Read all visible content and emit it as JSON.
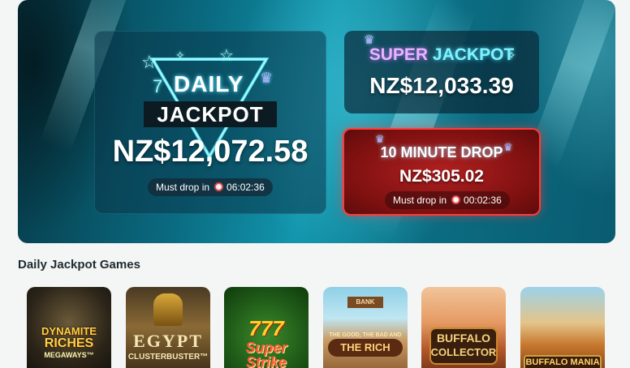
{
  "daily": {
    "word1": "DAILY",
    "word2": "JACKPOT",
    "amount": "NZ$12,072.58",
    "must_drop_label": "Must drop in",
    "timer": "06:02:36"
  },
  "super": {
    "title_part1": "SUPER",
    "title_part2": "JACKPOT",
    "amount": "NZ$12,033.39"
  },
  "ten_minute": {
    "title": "10 MINUTE DROP",
    "amount": "NZ$305.02",
    "must_drop_label": "Must drop in",
    "timer": "00:02:36"
  },
  "section": {
    "title": "Daily Jackpot Games"
  },
  "games": [
    {
      "title": "DYNAMITE",
      "subtitle": "RICHES",
      "extra": "MEGAWAYS™"
    },
    {
      "title": "EGYPT",
      "subtitle": "CLUSTERBUSTER™",
      "extra": ""
    },
    {
      "title": "Super",
      "subtitle": "Strike",
      "extra": ""
    },
    {
      "title": "THE GOOD, THE BAD AND",
      "subtitle": "THE RICH",
      "extra": "BANK"
    },
    {
      "title": "BUFFALO",
      "subtitle": "COLLECTOR",
      "extra": ""
    },
    {
      "title": "BUFFALO MANIA",
      "subtitle": "",
      "extra": ""
    }
  ],
  "colors": {
    "hero_teal": "#0a6a80",
    "drop_red": "#b02020",
    "drop_border": "#ff3b3b",
    "super_pink": "#e9b3ff",
    "super_cyan": "#7ff3ff"
  },
  "icons": [
    "star-icon",
    "crown-icon",
    "clock-icon",
    "sparkle-icon"
  ]
}
